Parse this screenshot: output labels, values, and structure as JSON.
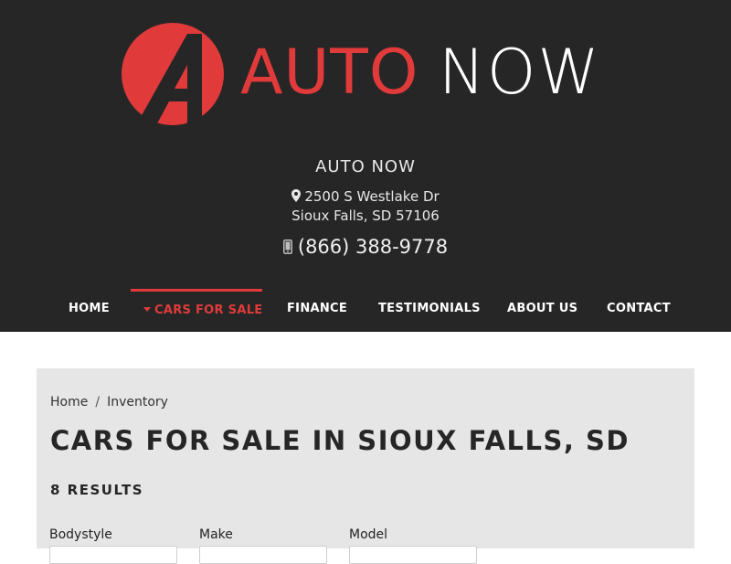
{
  "logo": {
    "mark_letter": "A",
    "word_auto": "AUTO",
    "word_now": "NOW"
  },
  "dealer": {
    "name": "AUTO NOW",
    "address_line1": "2500 S Westlake Dr",
    "address_line2": "Sioux Falls, SD 57106",
    "phone": "(866) 388-9778"
  },
  "nav": {
    "items": [
      {
        "label": "HOME"
      },
      {
        "label": "CARS FOR SALE",
        "active": true
      },
      {
        "label": "FINANCE"
      },
      {
        "label": "TESTIMONIALS"
      },
      {
        "label": "ABOUT US"
      },
      {
        "label": "CONTACT"
      }
    ]
  },
  "breadcrumb": {
    "home": "Home",
    "separator": "/",
    "current": "Inventory"
  },
  "page": {
    "title": "CARS FOR SALE IN SIOUX FALLS, SD",
    "results": "8 RESULTS"
  },
  "filters": {
    "bodystyle_label": "Bodystyle",
    "make_label": "Make",
    "model_label": "Model"
  },
  "colors": {
    "header_bg": "#262626",
    "accent": "#e03a3a",
    "panel_bg": "#e6e6e6"
  },
  "icons": {
    "address": "map-pin-icon",
    "phone": "mobile-phone-icon",
    "nav_active": "caret-down-icon"
  }
}
